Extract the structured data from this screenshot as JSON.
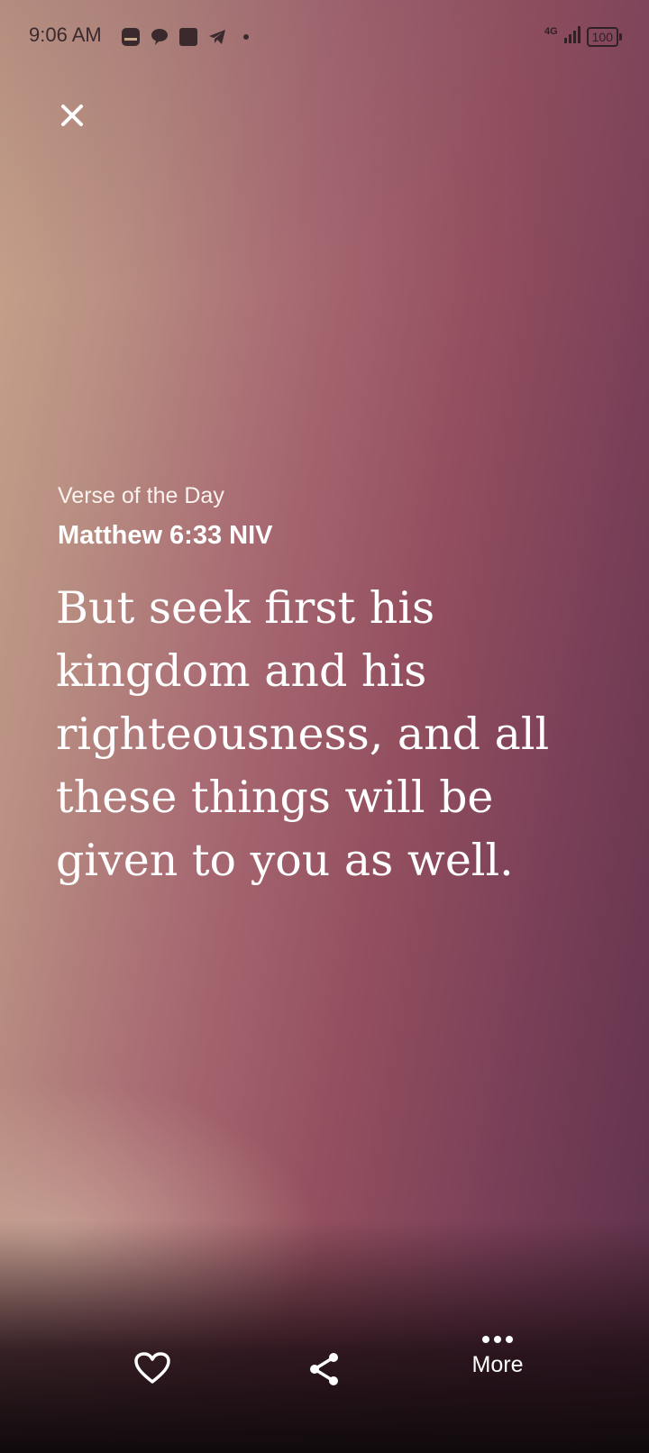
{
  "status_bar": {
    "time": "9:06 AM",
    "network": "4G",
    "battery": "100"
  },
  "verse": {
    "label": "Verse of the Day",
    "reference": "Matthew 6:33 NIV",
    "text": "But seek first his kingdom and his righteousness, and all these things will be given to you as well."
  },
  "actions": {
    "more_label": "More"
  },
  "colors": {
    "text": "#ffffff",
    "status_text": "#3a2a2e",
    "bg_left": "#c9a58c",
    "bg_right": "#5d314a"
  }
}
